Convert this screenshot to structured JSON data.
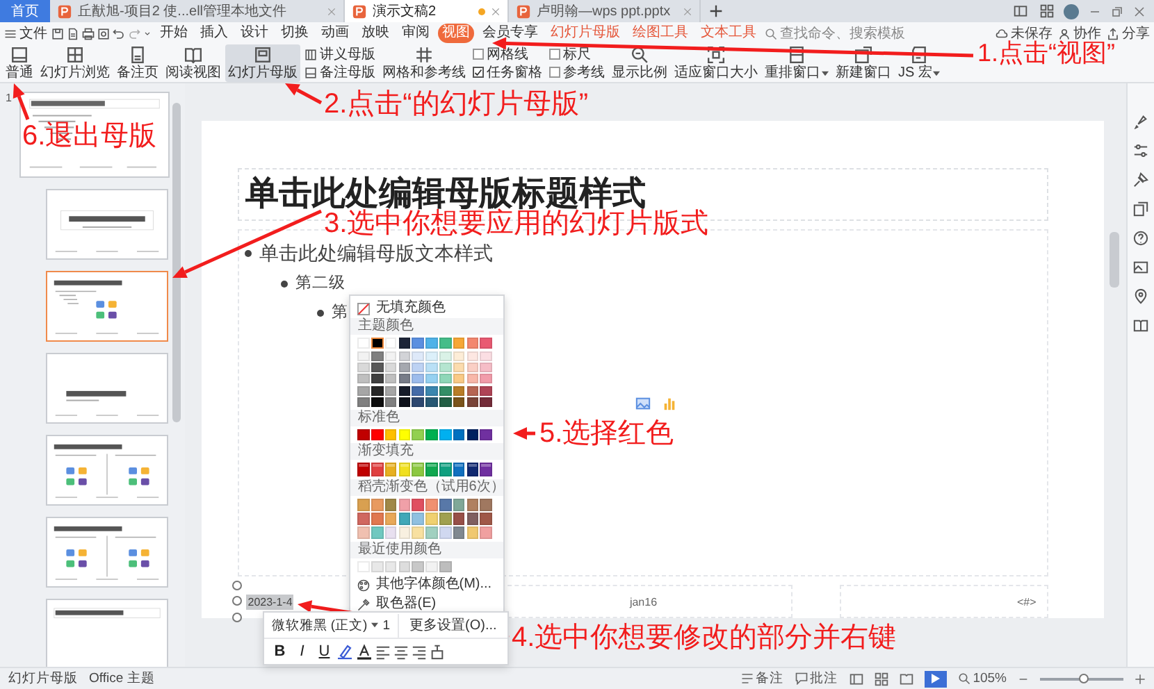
{
  "title_tabs": [
    {
      "label": "首页",
      "kind": "home",
      "selected": false
    },
    {
      "label": "丘猷旭-项目2 使...ell管理本地文件",
      "kind": "doc",
      "selected": false,
      "modified": false
    },
    {
      "label": "演示文稿2",
      "kind": "doc",
      "selected": true,
      "modified": true
    },
    {
      "label": "卢明翰—wps ppt.pptx",
      "kind": "doc",
      "selected": false,
      "modified": false
    }
  ],
  "menu": {
    "file": "文件",
    "tabs": [
      {
        "label": "开始",
        "kind": "normal",
        "selected": false
      },
      {
        "label": "插入",
        "kind": "normal",
        "selected": false
      },
      {
        "label": "设计",
        "kind": "normal",
        "selected": false
      },
      {
        "label": "切换",
        "kind": "normal",
        "selected": false
      },
      {
        "label": "动画",
        "kind": "normal",
        "selected": false
      },
      {
        "label": "放映",
        "kind": "normal",
        "selected": false
      },
      {
        "label": "审阅",
        "kind": "normal",
        "selected": false
      },
      {
        "label": "视图",
        "kind": "normal",
        "selected": true
      },
      {
        "label": "会员专享",
        "kind": "normal",
        "selected": false
      },
      {
        "label": "幻灯片母版",
        "kind": "context",
        "selected": false
      },
      {
        "label": "绘图工具",
        "kind": "context",
        "selected": false
      },
      {
        "label": "文本工具",
        "kind": "context",
        "selected": false
      }
    ],
    "search": "查找命令、搜索模板",
    "actions": [
      "未保存",
      "协作",
      "分享"
    ]
  },
  "toolbar": [
    {
      "kind": "big",
      "label": "普通",
      "selected": false,
      "dropdown": false
    },
    {
      "kind": "big",
      "label": "幻灯片浏览",
      "selected": false,
      "dropdown": false
    },
    {
      "kind": "big",
      "label": "备注页",
      "selected": false,
      "dropdown": false
    },
    {
      "kind": "big",
      "label": "阅读视图",
      "selected": false,
      "dropdown": false
    },
    {
      "kind": "big",
      "label": "幻灯片母版",
      "selected": true,
      "dropdown": false
    },
    {
      "kind": "stack",
      "items": [
        "讲义母版",
        "备注母版"
      ]
    },
    {
      "kind": "big",
      "label": "网格和参考线",
      "selected": false,
      "dropdown": false
    },
    {
      "kind": "checks",
      "items": [
        {
          "label": "网格线",
          "checked": false
        },
        {
          "label": "任务窗格",
          "checked": true
        }
      ]
    },
    {
      "kind": "checks",
      "items": [
        {
          "label": "标尺",
          "checked": false
        },
        {
          "label": "参考线",
          "checked": false
        }
      ]
    },
    {
      "kind": "big",
      "label": "显示比例",
      "selected": false,
      "dropdown": false
    },
    {
      "kind": "big",
      "label": "适应窗口大小",
      "selected": false,
      "dropdown": false
    },
    {
      "kind": "big",
      "label": "重排窗口",
      "selected": false,
      "dropdown": true
    },
    {
      "kind": "big",
      "label": "新建窗口",
      "selected": false,
      "dropdown": false
    },
    {
      "kind": "big",
      "label": "JS 宏",
      "selected": false,
      "dropdown": true
    }
  ],
  "thumbnails": [
    {
      "kind": "master",
      "number": "1",
      "selected": false
    },
    {
      "kind": "title",
      "selected": false
    },
    {
      "kind": "content",
      "selected": true
    },
    {
      "kind": "section",
      "selected": false
    },
    {
      "kind": "two",
      "selected": false
    },
    {
      "kind": "compare",
      "selected": false
    },
    {
      "kind": "title_only",
      "selected": false
    }
  ],
  "slide": {
    "title": "单击此处编辑母版标题样式",
    "bullets": [
      {
        "text": "单击此处编辑母版文本样式",
        "children": [
          {
            "text": "第二级",
            "children": [
              {
                "text": "第"
              }
            ]
          }
        ]
      }
    ],
    "footer": {
      "date": "2023-1-4",
      "date_selected": true,
      "center": "jan16",
      "number": "<#>"
    }
  },
  "color_picker": {
    "no_fill": "无填充颜色",
    "theme_label": "主题颜色",
    "theme": [
      {
        "color": "#ffffff",
        "selected": false
      },
      {
        "color": "#000000",
        "selected": true
      },
      {
        "color": "#ffffff",
        "selected": false
      },
      {
        "color": "#1d2538",
        "selected": false
      },
      {
        "color": "#5b8fe0",
        "selected": false
      },
      {
        "color": "#4fb2e8",
        "selected": false
      },
      {
        "color": "#45bd89",
        "selected": false
      },
      {
        "color": "#f7a735",
        "selected": false
      },
      {
        "color": "#f3876f",
        "selected": false
      },
      {
        "color": "#e95a72",
        "selected": false
      }
    ],
    "standard_label": "标准色",
    "standard": [
      {
        "color": "#c00000"
      },
      {
        "color": "#ff0000"
      },
      {
        "color": "#ffc000"
      },
      {
        "color": "#ffff00"
      },
      {
        "color": "#92d050"
      },
      {
        "color": "#00b050"
      },
      {
        "color": "#00b0f0"
      },
      {
        "color": "#0070c0"
      },
      {
        "color": "#002060"
      },
      {
        "color": "#7030a0"
      }
    ],
    "gradient_label": "渐变填充",
    "gradient": [
      {
        "color": "#c00000"
      },
      {
        "color": "#e04040"
      },
      {
        "color": "#e8b020"
      },
      {
        "color": "#f0e020"
      },
      {
        "color": "#8cc840"
      },
      {
        "color": "#10a850"
      },
      {
        "color": "#10a080"
      },
      {
        "color": "#1070c0"
      },
      {
        "color": "#102870"
      },
      {
        "color": "#7030a0"
      }
    ],
    "docer_label": "稻壳渐变色（试用6次）",
    "docer": [
      {
        "color": "#d9a050"
      },
      {
        "color": "#e89a60"
      },
      {
        "color": "#a08848"
      },
      {
        "color": "#f0a0a8"
      },
      {
        "color": "#e05060"
      },
      {
        "color": "#f09070"
      },
      {
        "color": "#5878a8"
      },
      {
        "color": "#80a898"
      },
      {
        "color": "#b08060"
      },
      {
        "color": "#a07860"
      },
      {
        "color": "#d06860"
      },
      {
        "color": "#e07850"
      },
      {
        "color": "#e8a858"
      },
      {
        "color": "#40a8b8"
      },
      {
        "color": "#90c0e0"
      },
      {
        "color": "#f0d070"
      },
      {
        "color": "#a0a050"
      },
      {
        "color": "#985048"
      },
      {
        "color": "#806060"
      },
      {
        "color": "#a05848"
      },
      {
        "color": "#f0c0b0"
      },
      {
        "color": "#70c8c0"
      },
      {
        "color": "#e8e0f0"
      },
      {
        "color": "#f8f0e0"
      },
      {
        "color": "#f8e0a0"
      },
      {
        "color": "#a0d0c0"
      },
      {
        "color": "#d0d8f0"
      },
      {
        "color": "#808890"
      },
      {
        "color": "#f0c870"
      },
      {
        "color": "#f0a0a0"
      }
    ],
    "recent_label": "最近使用颜色",
    "recent": [
      {
        "color": "#ffffff"
      },
      {
        "color": "#e8e8e8"
      },
      {
        "color": "#e8e8e8"
      },
      {
        "color": "#dddddd"
      },
      {
        "color": "#c8c8c8"
      },
      {
        "color": "#f2f2f2"
      },
      {
        "color": "#bdbdbd"
      }
    ],
    "more": "其他字体颜色(M)...",
    "eyedropper": "取色器(E)"
  },
  "mini_toolbar": {
    "font": "微软雅黑 (正文)",
    "size": "1",
    "more_settings": "更多设置(O)...",
    "buttons": [
      "B",
      "I",
      "U"
    ]
  },
  "status_bar": {
    "layout": "幻灯片母版",
    "theme": "Office 主题",
    "notes": "备注",
    "comments": "批注",
    "zoom": "105%",
    "zoom_slider": {
      "level": 0.52
    }
  },
  "annotations": [
    "1.点击“视图”",
    "2.点击“的幻灯片母版”",
    "6.退出母版",
    "3.选中你想要应用的幻灯片版式",
    "5.选择红色",
    "4.选中你想要修改的部分并右键"
  ]
}
